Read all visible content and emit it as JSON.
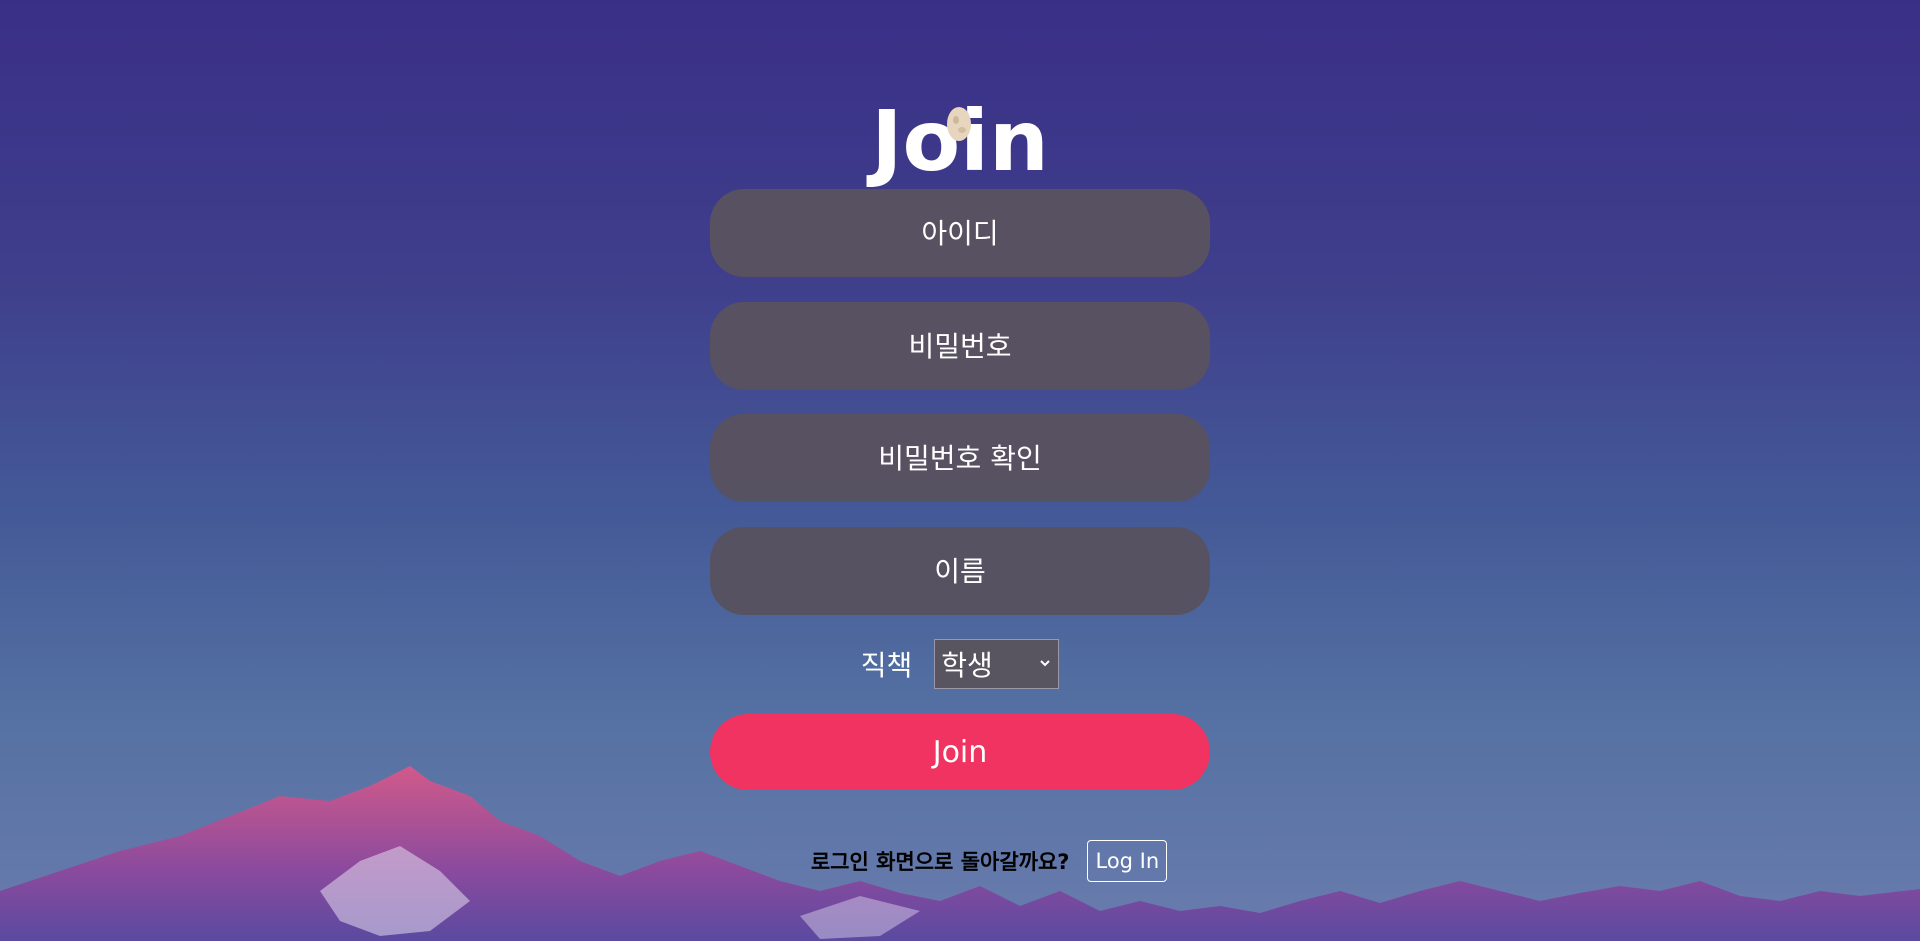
{
  "header": {
    "title": "Join"
  },
  "form": {
    "username_placeholder": "아이디",
    "password_placeholder": "비밀번호",
    "password_confirm_placeholder": "비밀번호 확인",
    "name_placeholder": "이름",
    "role_label": "직책",
    "role_selected": "학생",
    "submit_label": "Join"
  },
  "footer": {
    "prompt": "로그인 화면으로 돌아갈까요?",
    "login_label": "Log In"
  },
  "icons": {
    "moon": "moon-icon",
    "select_arrow": "chevron-down-icon"
  },
  "colors": {
    "join_button": "#f03360",
    "input_background": "#585260",
    "text": "#ffffff"
  }
}
